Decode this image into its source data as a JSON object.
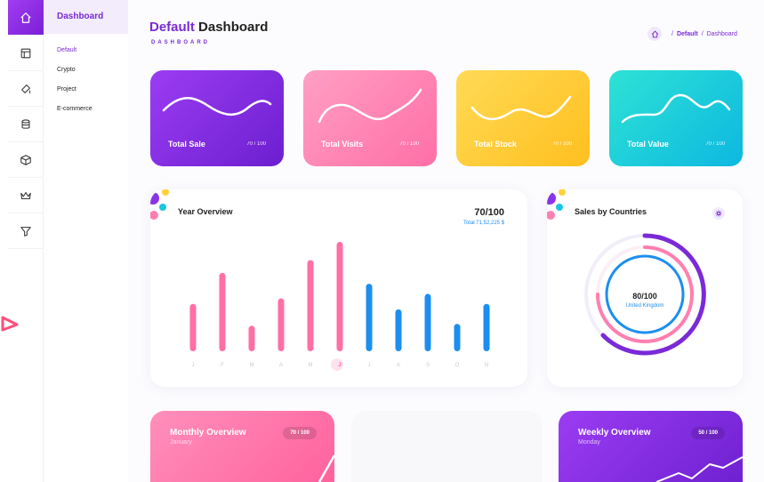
{
  "sidebar": {
    "icons": [
      {
        "name": "home-icon",
        "active": true
      },
      {
        "name": "layout-icon"
      },
      {
        "name": "paint-icon"
      },
      {
        "name": "database-icon"
      },
      {
        "name": "box-icon"
      },
      {
        "name": "crown-icon"
      },
      {
        "name": "filter-icon"
      }
    ],
    "title": "Dashboard",
    "items": [
      {
        "label": "Default",
        "active": true
      },
      {
        "label": "Crypto"
      },
      {
        "label": "Project"
      },
      {
        "label": "E-commerce"
      }
    ]
  },
  "header": {
    "title_accent": "Default",
    "title_rest": "Dashboard",
    "subtitle": "DASHBOARD"
  },
  "breadcrumb": {
    "sep": "/",
    "link": "Default",
    "current": "Dashboard"
  },
  "stats": [
    {
      "label": "Total Sale",
      "score": "70 / 100",
      "colors": [
        "#9b3cf3",
        "#6c1fcf"
      ]
    },
    {
      "label": "Total Visits",
      "score": "70 / 100",
      "colors": [
        "#ff9fc3",
        "#ff6fa6"
      ]
    },
    {
      "label": "Total Stock",
      "score": "70 / 100",
      "colors": [
        "#ffda55",
        "#ffbf1f"
      ]
    },
    {
      "label": "Total Value",
      "score": "70 / 100",
      "colors": [
        "#2ee2d5",
        "#0db8e0"
      ]
    }
  ],
  "year_overview": {
    "title": "Year Overview",
    "score": "70/100",
    "total": "Total 71,52,225 $",
    "active_month": "J",
    "months": [
      "J",
      "F",
      "M",
      "A",
      "M",
      "J",
      "J",
      "A",
      "S",
      "O",
      "N"
    ]
  },
  "chart_data": {
    "type": "bar",
    "categories": [
      "J",
      "F",
      "M",
      "A",
      "M",
      "J",
      "J",
      "A",
      "S",
      "O",
      "N"
    ],
    "values": [
      52,
      86,
      28,
      58,
      100,
      120,
      74,
      46,
      63,
      30,
      52
    ],
    "colors": [
      "#ff6fa6",
      "#ff6fa6",
      "#ff6fa6",
      "#ff6fa6",
      "#ff6fa6",
      "#ff6fa6",
      "#1c8ef0",
      "#1c8ef0",
      "#1c8ef0",
      "#1c8ef0",
      "#1c8ef0"
    ],
    "ylim": [
      0,
      120
    ]
  },
  "sales_countries": {
    "title": "Sales by Countries",
    "value": "80/100",
    "country": "United Kingdom"
  },
  "monthly": {
    "title": "Monthly Overview",
    "sub": "January",
    "score": "70 / 100"
  },
  "weekly": {
    "title": "Weekly Overview",
    "sub": "Monday",
    "score": "50 / 100"
  },
  "colors": {
    "purple": "#7a2ad6",
    "pink": "#ff6fa6",
    "blue": "#1c8ef0"
  }
}
